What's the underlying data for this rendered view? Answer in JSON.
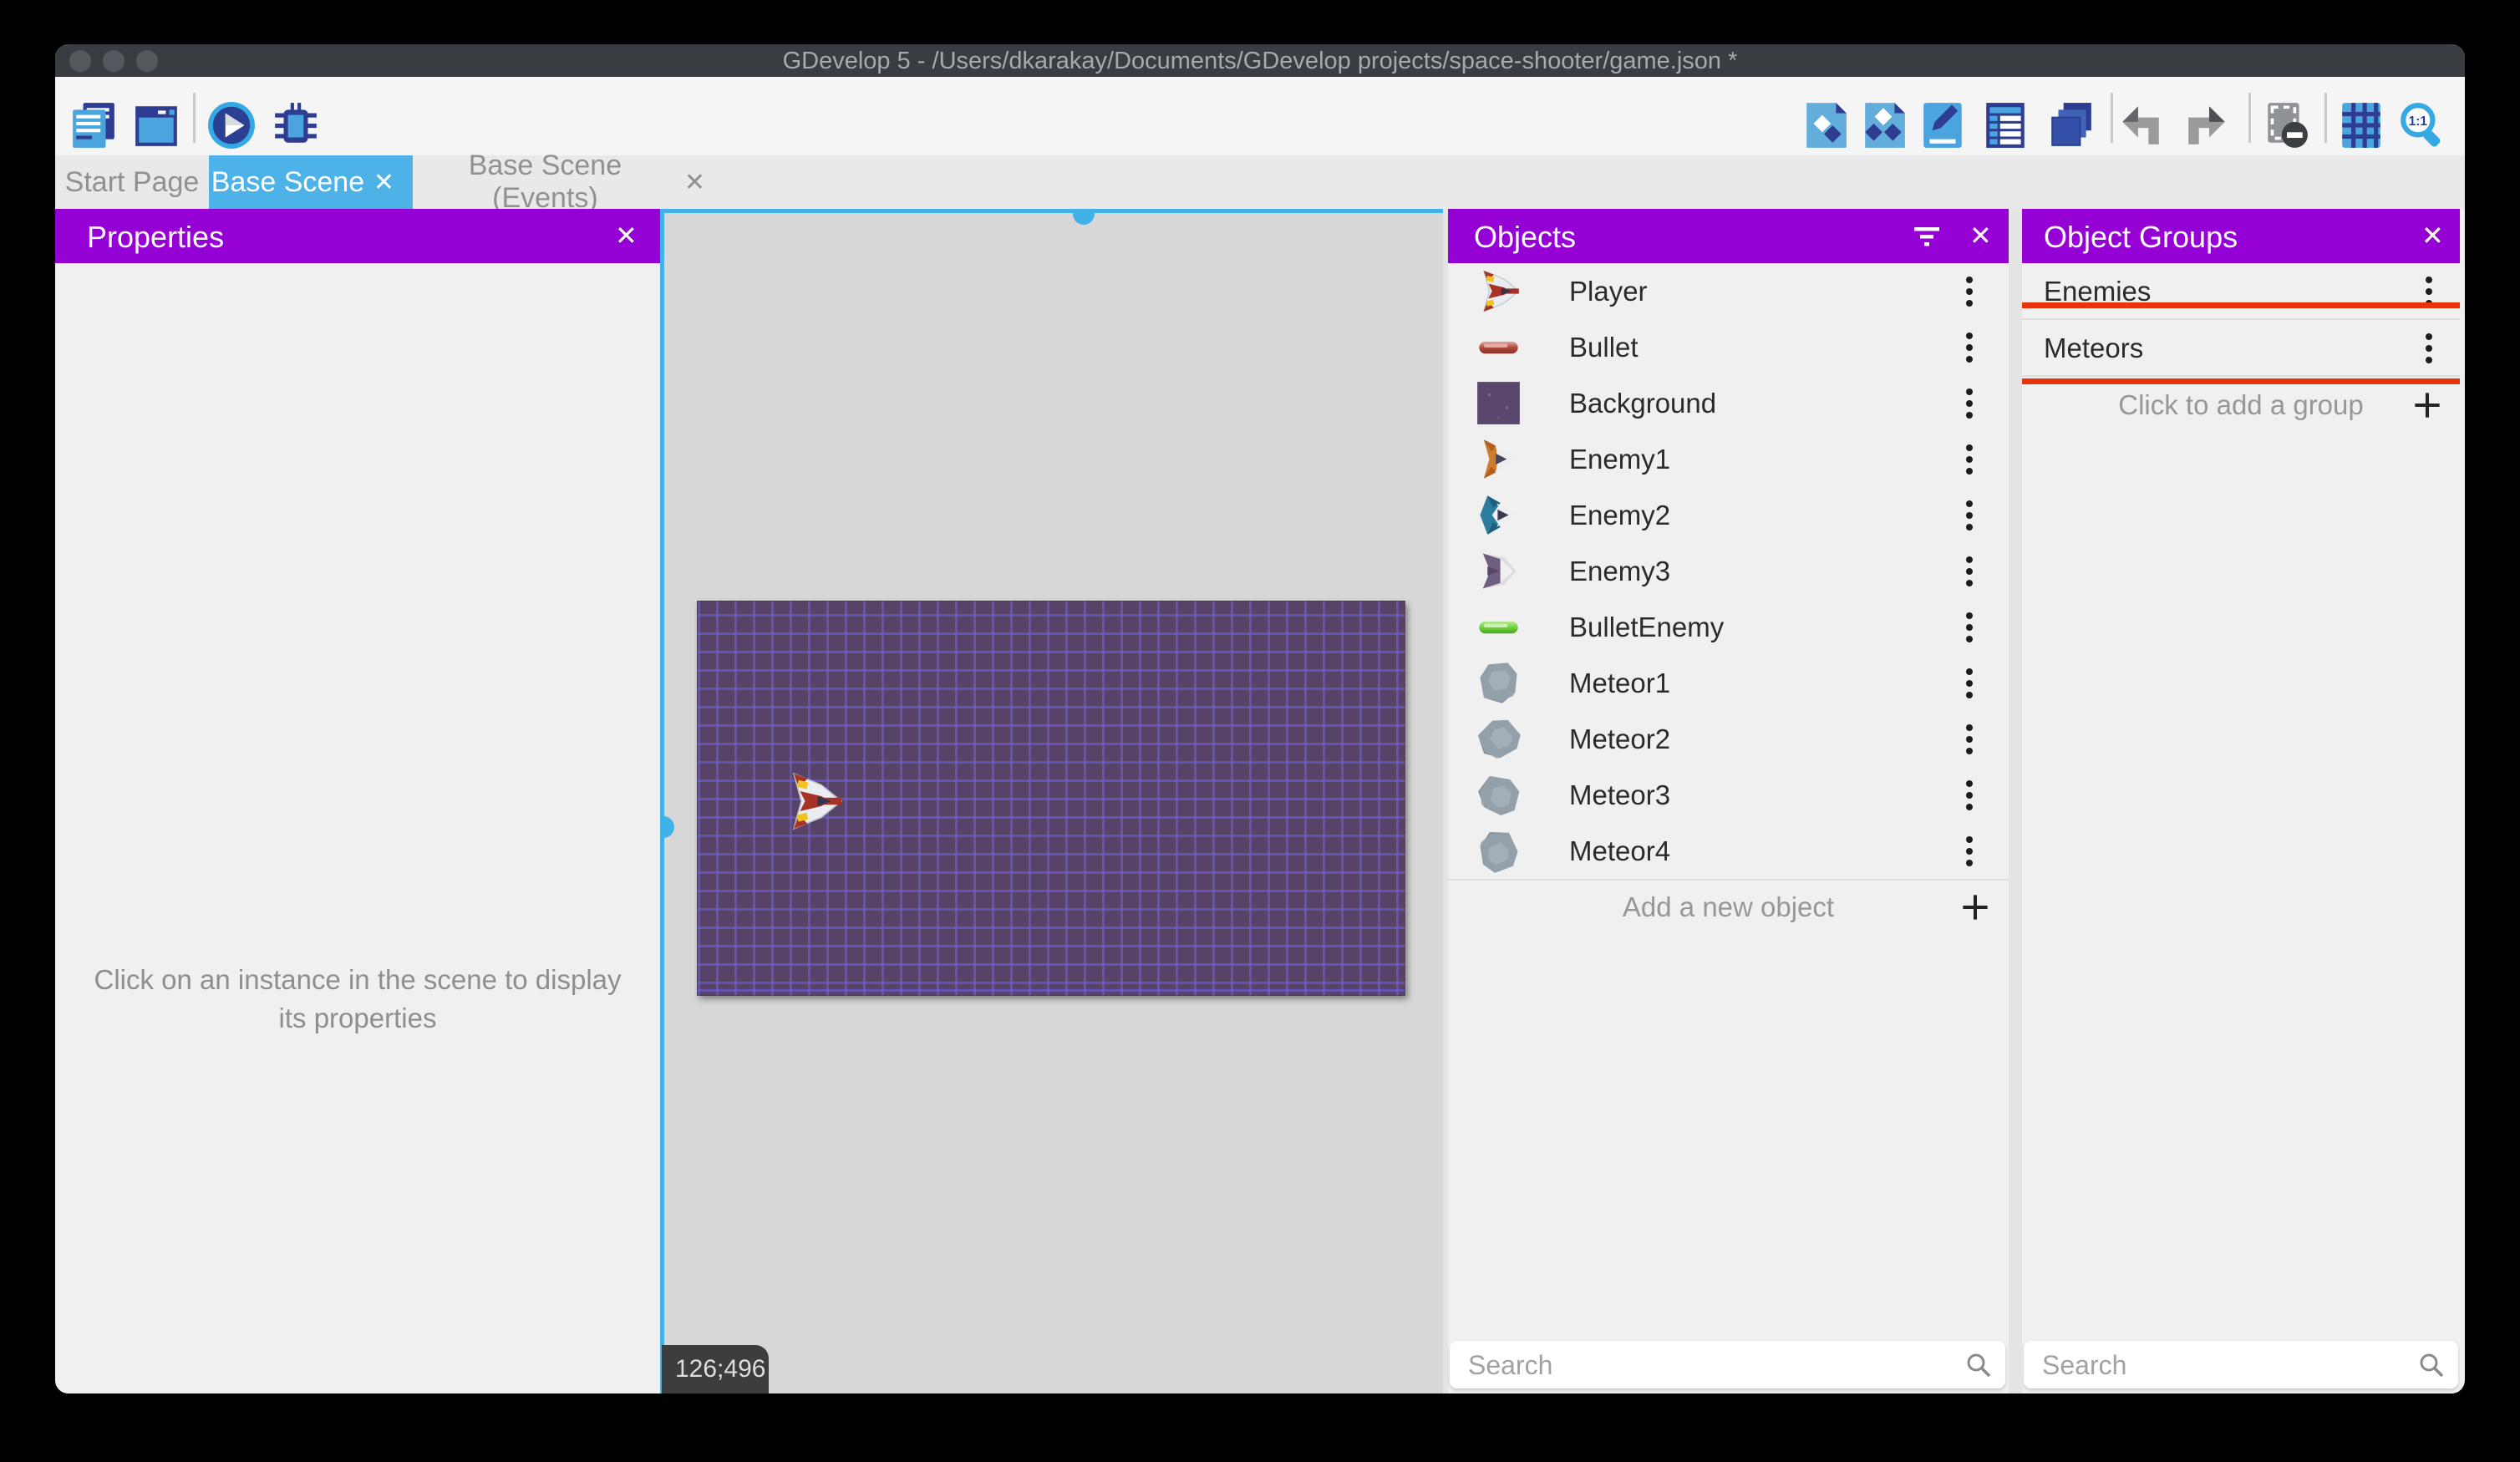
{
  "window_title": "GDevelop 5 - /Users/dkarakay/Documents/GDevelop projects/space-shooter/game.json *",
  "toolbar": {
    "left_icons": [
      "project-manager-icon",
      "scene-window-icon",
      "play-preview-icon",
      "debug-icon"
    ],
    "right_icons": [
      "add-object-icon",
      "instances-list-icon",
      "edit-scene-icon",
      "scene-properties-icon",
      "layers-icon",
      "undo-icon",
      "redo-icon",
      "toggle-mask-icon",
      "toggle-grid-icon",
      "zoom-original-icon"
    ]
  },
  "tabs": [
    {
      "label": "Start Page",
      "active": false,
      "closable": false
    },
    {
      "label": "Base Scene",
      "active": true,
      "closable": true
    },
    {
      "label": "Base Scene (Events)",
      "active": false,
      "closable": true
    }
  ],
  "properties_panel": {
    "title": "Properties",
    "empty_message": "Click on an instance in the scene to display its properties"
  },
  "scene": {
    "coordinates_badge": "126;496"
  },
  "objects_panel": {
    "title": "Objects",
    "items": [
      {
        "label": "Player",
        "icon": "player-ship-icon"
      },
      {
        "label": "Bullet",
        "icon": "bullet-red-icon"
      },
      {
        "label": "Background",
        "icon": "background-icon"
      },
      {
        "label": "Enemy1",
        "icon": "enemy1-ship-icon"
      },
      {
        "label": "Enemy2",
        "icon": "enemy2-ship-icon"
      },
      {
        "label": "Enemy3",
        "icon": "enemy3-ship-icon"
      },
      {
        "label": "BulletEnemy",
        "icon": "bullet-green-icon"
      },
      {
        "label": "Meteor1",
        "icon": "meteor-icon"
      },
      {
        "label": "Meteor2",
        "icon": "meteor-icon"
      },
      {
        "label": "Meteor3",
        "icon": "meteor-icon"
      },
      {
        "label": "Meteor4",
        "icon": "meteor-icon"
      }
    ],
    "add_button_label": "Add a new object",
    "search_placeholder": "Search"
  },
  "groups_panel": {
    "title": "Object Groups",
    "items": [
      {
        "label": "Enemies",
        "highlighted": false
      },
      {
        "label": "Meteors",
        "highlighted": true
      }
    ],
    "add_button_label": "Click to add a group",
    "search_placeholder": "Search"
  },
  "colors": {
    "header_purple": "#9500d4",
    "active_tab_blue": "#4db2e8",
    "selection_cyan": "#41b2e8",
    "annotation_red": "#e8330c",
    "scene_background_purple": "#564367"
  }
}
